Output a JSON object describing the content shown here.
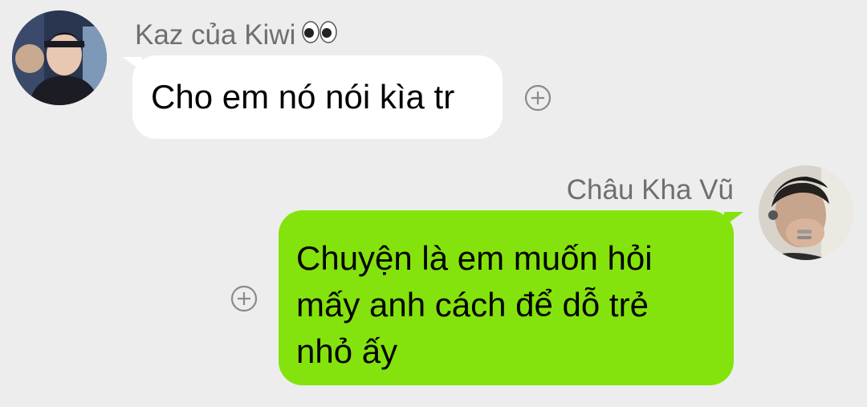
{
  "messages": [
    {
      "sender": "Kaz của Kiwi",
      "sender_emoji_icon": "eyes-emoji-icon",
      "lines": [
        "Cho em nó nói kìa tr"
      ],
      "side": "left",
      "bubble_color": "#ffffff"
    },
    {
      "sender": "Châu Kha Vũ",
      "lines": [
        "Chuyện là em muốn hỏi",
        "mấy anh cách để dỗ trẻ",
        "nhỏ ấy"
      ],
      "side": "right",
      "bubble_color": "#84e30c"
    }
  ],
  "icons": {
    "reaction": "add-reaction-icon",
    "avatar": "avatar-photo"
  },
  "colors": {
    "background": "#ededed",
    "name_text": "#6f6f6f",
    "outgoing_bubble": "#84e30c",
    "incoming_bubble": "#ffffff"
  }
}
